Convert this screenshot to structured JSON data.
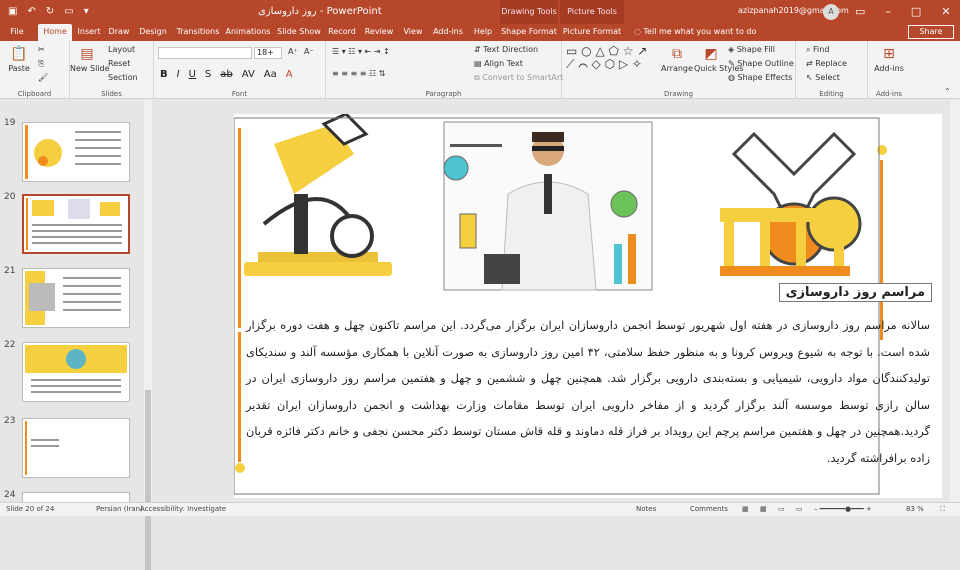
{
  "titlebar": {
    "doc_title": "روز داروسازی  -  PowerPoint",
    "context_drawing": "Drawing Tools",
    "context_picture": "Picture Tools",
    "user_email": "azizpanah2019@gmail.com",
    "avatar": "A"
  },
  "tabs": [
    "File",
    "Home",
    "Insert",
    "Draw",
    "Design",
    "Transitions",
    "Animations",
    "Slide Show",
    "Record",
    "Review",
    "View",
    "Add-ins",
    "Help",
    "Shape Format",
    "Picture Format"
  ],
  "tellme": "Tell me what you want to do",
  "share": "Share",
  "ribbon": {
    "clipboard": {
      "label": "Clipboard",
      "paste": "Paste"
    },
    "slides": {
      "label": "Slides",
      "new_slide": "New Slide",
      "layout": "Layout",
      "reset": "Reset",
      "section": "Section"
    },
    "font": {
      "label": "Font",
      "font_name": "",
      "font_size": "18+"
    },
    "paragraph": {
      "label": "Paragraph",
      "text_direction": "Text Direction",
      "align_text": "Align Text",
      "convert": "Convert to SmartArt"
    },
    "drawing": {
      "label": "Drawing",
      "arrange": "Arrange",
      "quick_styles": "Quick Styles",
      "shape_fill": "Shape Fill",
      "shape_outline": "Shape Outline",
      "shape_effects": "Shape Effects"
    },
    "editing": {
      "label": "Editing",
      "find": "Find",
      "replace": "Replace",
      "select": "Select"
    },
    "addins": {
      "label": "Add-ins",
      "addins": "Add-ins"
    }
  },
  "thumbnails": [
    {
      "num": "19",
      "selected": false
    },
    {
      "num": "20",
      "selected": true
    },
    {
      "num": "21",
      "selected": false
    },
    {
      "num": "22",
      "selected": false
    },
    {
      "num": "23",
      "selected": false
    },
    {
      "num": "24",
      "selected": false
    }
  ],
  "slide": {
    "title": "مراسم روز داروسازی",
    "body": "سالانه مراسم روز داروسازی در هفته اول شهریور توسط انجمن داروسازان ایران برگزار می‌گردد. این مراسم تاکنون چهل و هفت دوره برگزار شده است. با توجه به شیوع ویروس کرونا و به منظور حفظ سلامتی، ۴۲ امین روز داروسازی به صورت آنلاین با همکاری مؤسسه آلند و سندیکای تولیدکنندگان مواد دارویی، شیمیایی و بسته‌بندی دارویی برگزار شد. همچنین چهل و ششمین و چهل و هفتمین مراسم روز داروسازی ایران در سالن رازی توسط موسسه آلند برگزار گردید و از مفاخر دارویی ایران توسط مقامات وزارت بهداشت و انجمن داروسازان ایران تقدیر گردید.همچنین در چهل و هفتمین مراسم پرچم این رویداد بر فراز قله دماوند و قله قاش مستان توسط دکتر محسن نجفی و خانم دکتر فائزه قربان زاده برافراشته گردید."
  },
  "status": {
    "slide": "Slide 20 of 24",
    "language": "Persian (Iran)",
    "accessibility": "Accessibility: Investigate",
    "notes": "Notes",
    "comments": "Comments",
    "zoom": "83 %"
  },
  "colors": {
    "accent": "#b7472a",
    "slide_orange": "#f08c1e",
    "slide_yellow": "#f5cf3f"
  }
}
